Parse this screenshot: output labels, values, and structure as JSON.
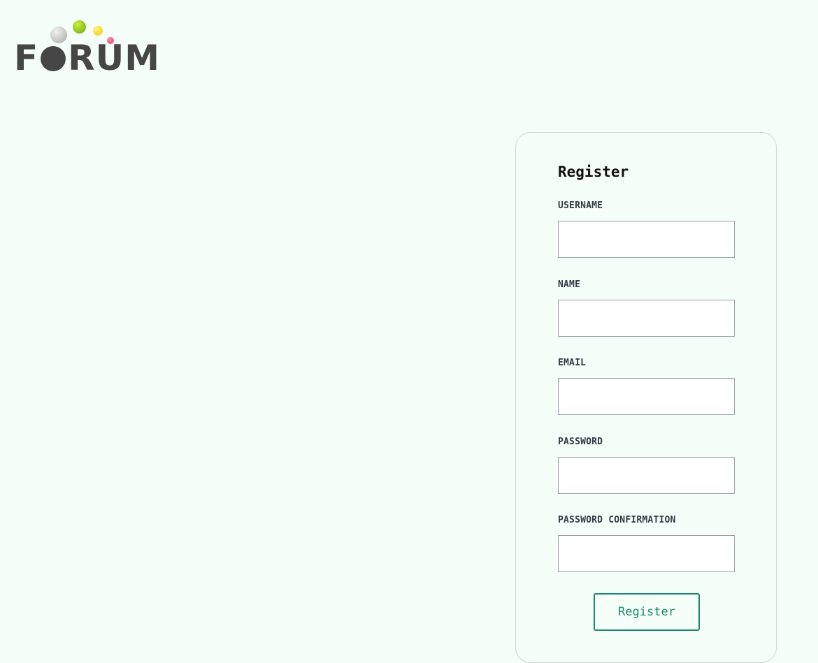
{
  "logo": {
    "text_before": "F",
    "text_after": "RUM",
    "dot_colors": [
      "#bdbdbd",
      "#8cc61a",
      "#f7d72b",
      "#f3547a"
    ]
  },
  "register_form": {
    "title": "Register",
    "fields": [
      {
        "label": "USERNAME",
        "value": "",
        "placeholder": ""
      },
      {
        "label": "NAME",
        "value": "",
        "placeholder": ""
      },
      {
        "label": "EMAIL",
        "value": "",
        "placeholder": ""
      },
      {
        "label": "PASSWORD",
        "value": "",
        "placeholder": ""
      },
      {
        "label": "PASSWORD CONFIRMATION",
        "value": "",
        "placeholder": ""
      }
    ],
    "submit_label": "Register"
  },
  "colors": {
    "background": "#f5fef9",
    "accent": "#1c8a6c",
    "logo_text": "#464646"
  }
}
